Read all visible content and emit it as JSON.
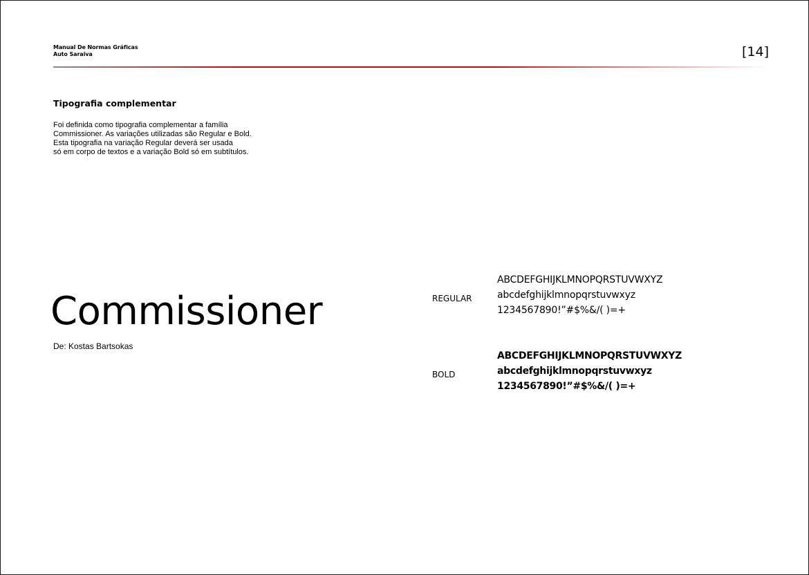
{
  "header": {
    "manual_title": "Manual De Normas Gráficas",
    "company": "Auto Saraiva",
    "page_number": "[14]"
  },
  "colors": {
    "accent_rule": "#a3161c"
  },
  "section": {
    "title": "Tipografia complementar",
    "body_lines": [
      "Foi definida como tipografia complementar a família",
      "Commissioner. As variações utilizadas são Regular e Bold.",
      "Esta tipografia na variação Regular deverá ser usada",
      "só em corpo de textos e a variação Bold só em subtítulos."
    ]
  },
  "specimen": {
    "family_name": "Commissioner",
    "designer": "De: Kostas Bartsokas",
    "variants": [
      {
        "label": "REGULAR",
        "uppercase": "ABCDEFGHIJKLMNOPQRSTUVWXYZ",
        "lowercase": "abcdefghijklmnopqrstuvwxyz",
        "numerals": "1234567890!”#$%&/( )=+"
      },
      {
        "label": "BOLD",
        "uppercase": "ABCDEFGHIJKLMNOPQRSTUVWXYZ",
        "lowercase": "abcdefghijklmnopqrstuvwxyz",
        "numerals": "1234567890!”#$%&/( )=+"
      }
    ]
  }
}
